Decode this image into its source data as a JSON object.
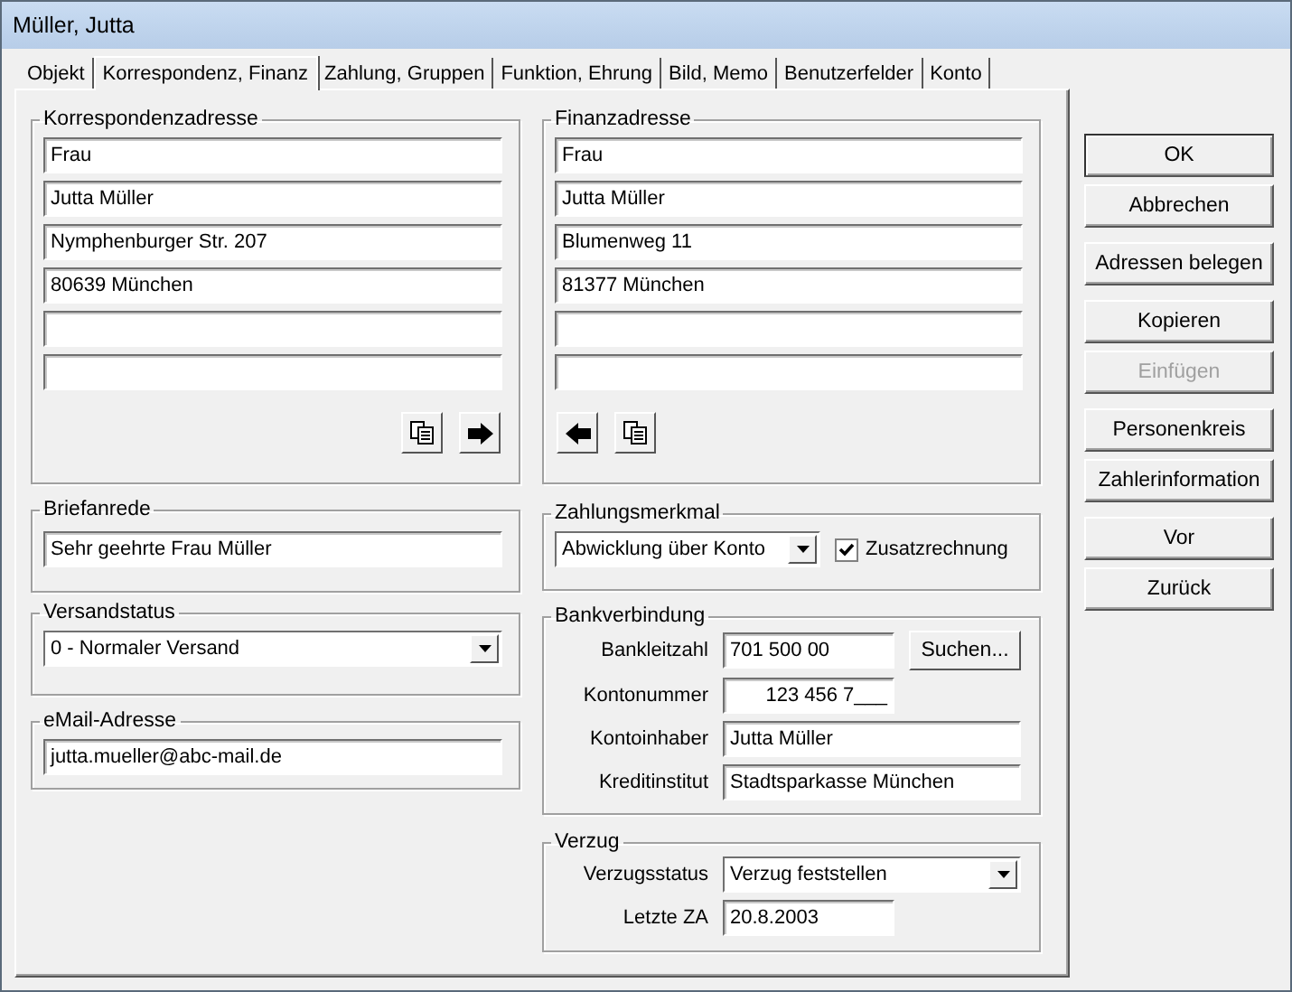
{
  "window": {
    "title": "Müller, Jutta"
  },
  "tabs": [
    {
      "label": "Objekt",
      "selected": false
    },
    {
      "label": "Korrespondenz, Finanz",
      "selected": true
    },
    {
      "label": "Zahlung, Gruppen",
      "selected": false
    },
    {
      "label": "Funktion, Ehrung",
      "selected": false
    },
    {
      "label": "Bild, Memo",
      "selected": false
    },
    {
      "label": "Benutzerfelder",
      "selected": false
    },
    {
      "label": "Konto",
      "selected": false
    }
  ],
  "correspondence_address": {
    "title": "Korrespondenzadresse",
    "fields": [
      {
        "kind": "text",
        "value": "Frau"
      },
      {
        "kind": "text",
        "value": "Jutta Müller"
      },
      {
        "kind": "text",
        "value": "Nymphenburger Str. 207"
      },
      {
        "kind": "text",
        "value": "80639 München"
      },
      {
        "kind": "blank"
      },
      {
        "kind": "blank"
      }
    ]
  },
  "finance_address": {
    "title": "Finanzadresse",
    "fields": [
      {
        "kind": "text",
        "value": "Frau"
      },
      {
        "kind": "text",
        "value": "Jutta Müller"
      },
      {
        "kind": "text",
        "value": "Blumenweg 11"
      },
      {
        "kind": "text",
        "value": "81377 München"
      },
      {
        "kind": "blank"
      },
      {
        "kind": "blank"
      }
    ]
  },
  "salutation": {
    "title": "Briefanrede",
    "value": "Sehr geehrte Frau Müller"
  },
  "shipping_status": {
    "title": "Versandstatus",
    "value": "0 - Normaler Versand"
  },
  "email": {
    "title": "eMail-Adresse",
    "value": "jutta.mueller@abc-mail.de"
  },
  "payment_feature": {
    "title": "Zahlungsmerkmal",
    "value": "Abwicklung über Konto",
    "checkbox": {
      "label": "Zusatzrechnung",
      "checked": true
    }
  },
  "bank": {
    "title": "Bankverbindung",
    "rows": [
      {
        "kind": "short",
        "label": "Bankleitzahl",
        "value": "701 500 00",
        "button": "Suchen..."
      },
      {
        "kind": "account",
        "label": "Kontonummer",
        "value": "123 456 7___"
      },
      {
        "kind": "wide",
        "label": "Kontoinhaber",
        "value": "Jutta Müller"
      },
      {
        "kind": "wide",
        "label": "Kreditinstitut",
        "value": "Stadtsparkasse München"
      }
    ]
  },
  "delay": {
    "title": "Verzug",
    "status_label": "Verzugsstatus",
    "status_value": "Verzug feststellen",
    "date_label": "Letzte ZA",
    "date_value": "20.8.2003"
  },
  "button_groups": [
    [
      {
        "label": "OK",
        "default": true,
        "disabled": false
      },
      {
        "label": "Abbrechen",
        "default": false,
        "disabled": false
      }
    ],
    [
      {
        "label": "Adressen belegen",
        "default": false,
        "disabled": false
      }
    ],
    [
      {
        "label": "Kopieren",
        "default": false,
        "disabled": false
      },
      {
        "label": "Einfügen",
        "default": false,
        "disabled": true
      }
    ],
    [
      {
        "label": "Personenkreis",
        "default": false,
        "disabled": false
      },
      {
        "label": "Zahlerinformation",
        "default": false,
        "disabled": false
      }
    ],
    [
      {
        "label": "Vor",
        "default": false,
        "disabled": false
      },
      {
        "label": "Zurück",
        "default": false,
        "disabled": false
      }
    ]
  ]
}
